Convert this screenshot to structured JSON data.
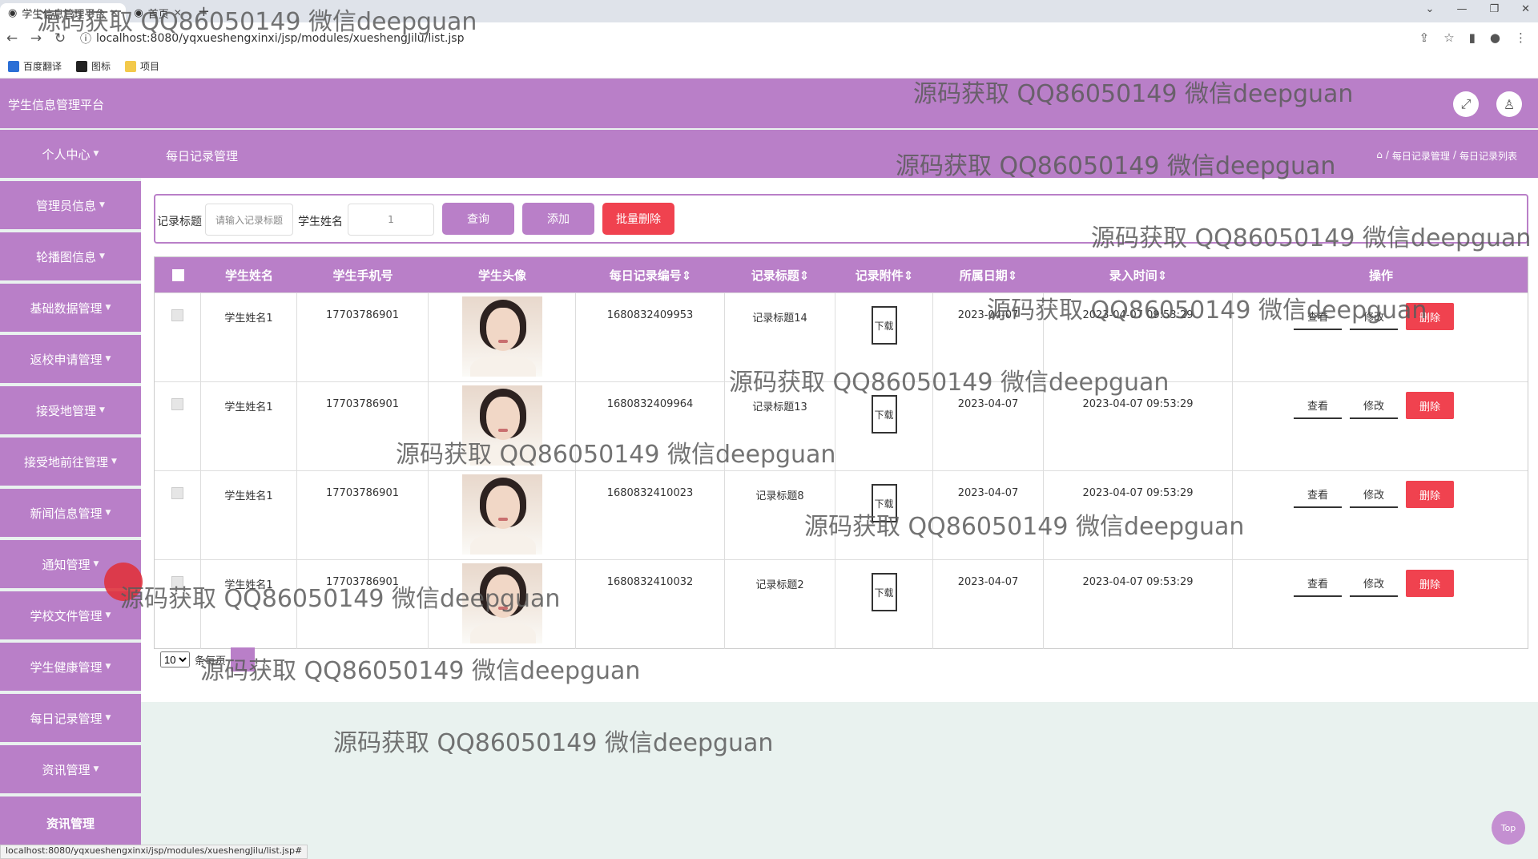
{
  "browser": {
    "tabs": [
      {
        "label": "学生信息管理平台"
      },
      {
        "label": "首页"
      }
    ],
    "new_tab": "+",
    "url": "localhost:8080/yqxueshengxinxi/jsp/modules/xueshengJilu/list.jsp",
    "bookmarks": [
      "百度翻译",
      "图标",
      "项目"
    ],
    "status_url": "localhost:8080/yqxueshengxinxi/jsp/modules/xueshengJilu/list.jsp#"
  },
  "app": {
    "title": "学生信息管理平台",
    "page_title": "每日记录管理",
    "breadcrumb": [
      "每日记录管理",
      "每日记录列表"
    ]
  },
  "sidebar": {
    "items": [
      {
        "label": "个人中心"
      },
      {
        "label": "管理员信息"
      },
      {
        "label": "轮播图信息"
      },
      {
        "label": "基础数据管理"
      },
      {
        "label": "返校申请管理"
      },
      {
        "label": "接受地管理"
      },
      {
        "label": "接受地前往管理"
      },
      {
        "label": "新闻信息管理"
      },
      {
        "label": "通知管理"
      },
      {
        "label": "学校文件管理"
      },
      {
        "label": "学生健康管理"
      },
      {
        "label": "每日记录管理"
      },
      {
        "label": "资讯管理"
      },
      {
        "label": "资讯管理"
      }
    ]
  },
  "search": {
    "title_label": "记录标题",
    "title_placeholder": "请输入记录标题",
    "name_label": "学生姓名",
    "name_value": "1",
    "query_button": "查询",
    "add_button": "添加",
    "batch_delete_button": "批量删除"
  },
  "table": {
    "headers": [
      "学生姓名",
      "学生手机号",
      "学生头像",
      "每日记录编号⇕",
      "记录标题⇕",
      "记录附件⇕",
      "所属日期⇕",
      "录入时间⇕",
      "操作"
    ],
    "download_label": "下载",
    "view_label": "查看",
    "edit_label": "修改",
    "delete_label": "删除",
    "rows": [
      {
        "name": "学生姓名1",
        "phone": "17703786901",
        "no": "1680832409953",
        "title": "记录标题14",
        "date": "2023-04-07",
        "time": "2023-04-07 09:53:29"
      },
      {
        "name": "学生姓名1",
        "phone": "17703786901",
        "no": "1680832409964",
        "title": "记录标题13",
        "date": "2023-04-07",
        "time": "2023-04-07 09:53:29"
      },
      {
        "name": "学生姓名1",
        "phone": "17703786901",
        "no": "1680832410023",
        "title": "记录标题8",
        "date": "2023-04-07",
        "time": "2023-04-07 09:53:29"
      },
      {
        "name": "学生姓名1",
        "phone": "17703786901",
        "no": "1680832410032",
        "title": "记录标题2",
        "date": "2023-04-07",
        "time": "2023-04-07 09:53:29"
      }
    ]
  },
  "pager": {
    "page_size": "10",
    "total_text": "条每页"
  },
  "top_button": "Top",
  "watermark": "源码获取 QQ86050149 微信deepguan",
  "colors": {
    "accent": "#b97fc8",
    "danger": "#f0424f",
    "background": "#e9f2ef"
  }
}
